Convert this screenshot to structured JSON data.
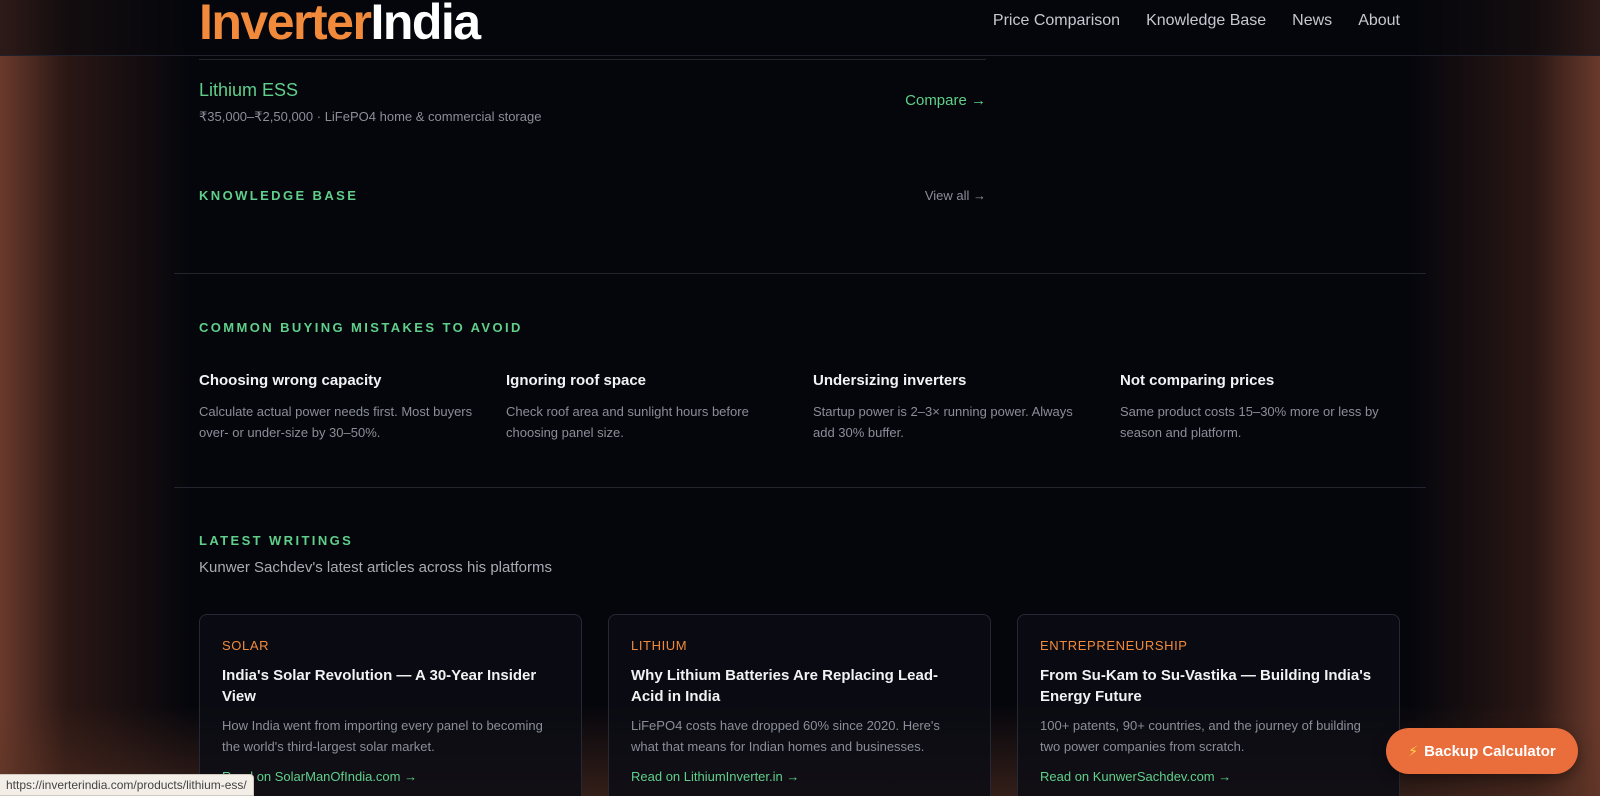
{
  "logo": {
    "part1": "Inverter",
    "part2": "India"
  },
  "nav": [
    "Price Comparison",
    "Knowledge Base",
    "News",
    "About"
  ],
  "product_row": {
    "title": "Lithium ESS",
    "subtitle": "₹35,000–₹2,50,000 · LiFePO4 home & commercial storage",
    "link": "Compare →"
  },
  "knowledge_base": {
    "label": "KNOWLEDGE BASE",
    "view_all": "View all →"
  },
  "mistakes": {
    "label": "COMMON BUYING MISTAKES TO AVOID",
    "items": [
      {
        "title": "Choosing wrong capacity",
        "body": "Calculate actual power needs first. Most buyers over- or under-size by 30–50%."
      },
      {
        "title": "Ignoring roof space",
        "body": "Check roof area and sunlight hours before choosing panel size."
      },
      {
        "title": "Undersizing inverters",
        "body": "Startup power is 2–3× running power. Always add 30% buffer."
      },
      {
        "title": "Not comparing prices",
        "body": "Same product costs 15–30% more or less by season and platform."
      }
    ]
  },
  "writings": {
    "label": "LATEST WRITINGS",
    "subtitle": "Kunwer Sachdev's latest articles across his platforms",
    "cards": [
      {
        "category": "SOLAR",
        "title": "India's Solar Revolution — A 30-Year Insider View",
        "body": "How India went from importing every panel to becoming the world's third-largest solar market.",
        "link": "Read on SolarManOfIndia.com →"
      },
      {
        "category": "LITHIUM",
        "title": "Why Lithium Batteries Are Replacing Lead-Acid in India",
        "body": "LiFePO4 costs have dropped 60% since 2020. Here's what that means for Indian homes and businesses.",
        "link": "Read on LithiumInverter.in →"
      },
      {
        "category": "ENTREPRENEURSHIP",
        "title": "From Su-Kam to Su-Vastika — Building India's Energy Future",
        "body": "100+ patents, 90+ countries, and the journey of building two power companies from scratch.",
        "link": "Read on KunwerSachdev.com →"
      }
    ]
  },
  "fab": {
    "icon": "⚡",
    "label": "Backup Calculator"
  },
  "status_url": "https://inverterindia.com/products/lithium-ess/",
  "colors": {
    "accent_orange": "#f28a3c",
    "accent_green": "#5fcf8a",
    "background": "#05060c",
    "fab": "#ea6e3c"
  }
}
